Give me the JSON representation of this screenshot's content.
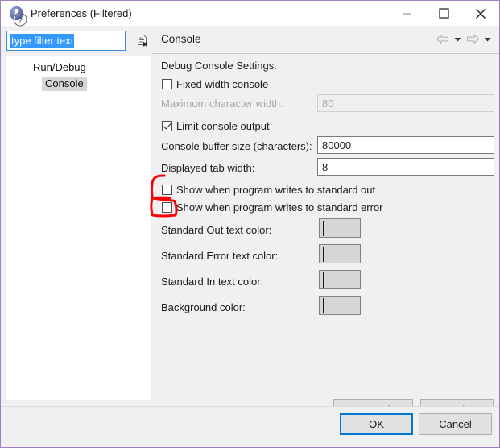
{
  "window": {
    "title": "Preferences (Filtered)",
    "icon": "preferences-app-icon",
    "border_color": "#9b7fbf",
    "controls": {
      "minimize": "minimize-icon",
      "maximize": "maximize-icon",
      "close": "close-icon"
    }
  },
  "filter": {
    "value": "type filter text",
    "placeholder": "type filter text",
    "clear_icon": "clear-filter-icon"
  },
  "tree": {
    "items": [
      {
        "label": "Run/Debug",
        "selected": false,
        "depth": 0
      },
      {
        "label": "Console",
        "selected": true,
        "depth": 1
      }
    ]
  },
  "page": {
    "title": "Console",
    "nav": {
      "back_icon": "back-arrow-icon",
      "back_caret_icon": "chevron-down-icon",
      "forward_icon": "forward-arrow-icon",
      "forward_caret_icon": "chevron-down-icon"
    },
    "section_title": "Debug Console Settings.",
    "checkboxes": [
      {
        "label": "Fixed width console",
        "checked": false
      },
      {
        "label": "Limit console output",
        "checked": true
      },
      {
        "label": "Show when program writes to standard out",
        "checked": false
      },
      {
        "label": "Show when program writes to standard error",
        "checked": false
      }
    ],
    "fields": [
      {
        "label": "Maximum character width:",
        "value": "80",
        "disabled": true
      },
      {
        "label": "Console buffer size (characters):",
        "value": "80000",
        "disabled": false
      },
      {
        "label": "Displayed tab width:",
        "value": "8",
        "disabled": false
      }
    ],
    "colors": [
      {
        "label": "Standard Out text color:",
        "value": "#000000"
      },
      {
        "label": "Standard Error text color:",
        "value": "#ff0000"
      },
      {
        "label": "Standard In text color:",
        "value": "#00c86e"
      },
      {
        "label": "Background color:",
        "value": "#ffffff"
      }
    ],
    "restore_defaults_label": "Restore Defaults",
    "apply_label": "Apply"
  },
  "annotation": {
    "color": "#fb0007",
    "shape": "hand-drawn-highlight"
  },
  "footer": {
    "help_icon": "help-icon",
    "ok_label": "OK",
    "cancel_label": "Cancel"
  }
}
